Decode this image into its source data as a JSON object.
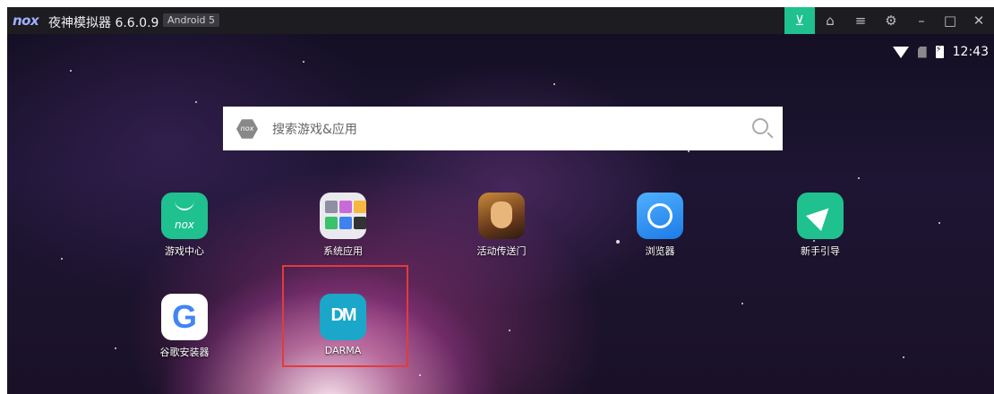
{
  "titlebar": {
    "logo": "nox",
    "app_title": "夜神模拟器 6.6.0.9",
    "android_badge": "Android 5",
    "buttons": [
      {
        "icon": "inbox-icon",
        "glyph": "⊻",
        "active": true
      },
      {
        "icon": "shirt-icon",
        "glyph": "⌂",
        "active": false
      },
      {
        "icon": "menu-icon",
        "glyph": "≡",
        "active": false
      },
      {
        "icon": "gear-icon",
        "glyph": "⚙",
        "active": false
      },
      {
        "icon": "minimize-icon",
        "glyph": "–",
        "active": false
      },
      {
        "icon": "maximize-icon",
        "glyph": "□",
        "active": false
      },
      {
        "icon": "close-icon",
        "glyph": "✕",
        "active": false
      }
    ]
  },
  "status_bar": {
    "time": "12:43"
  },
  "search": {
    "logo": "nox",
    "placeholder": "搜索游戏&应用"
  },
  "apps": [
    {
      "name": "游戏中心",
      "icon": "nox-game-center-icon",
      "icon_text": "nox"
    },
    {
      "name": "系统应用",
      "icon": "system-apps-folder-icon"
    },
    {
      "name": "活动传送门",
      "icon": "event-portal-icon"
    },
    {
      "name": "浏览器",
      "icon": "browser-icon"
    },
    {
      "name": "新手引导",
      "icon": "guide-arrow-icon"
    },
    {
      "name": "谷歌安装器",
      "icon": "google-installer-icon",
      "icon_text": "G"
    },
    {
      "name": "DARMA",
      "icon": "darma-icon",
      "icon_text": "DM"
    }
  ],
  "colors": {
    "accent": "#1fc18e",
    "highlight": "#e23b3b"
  }
}
